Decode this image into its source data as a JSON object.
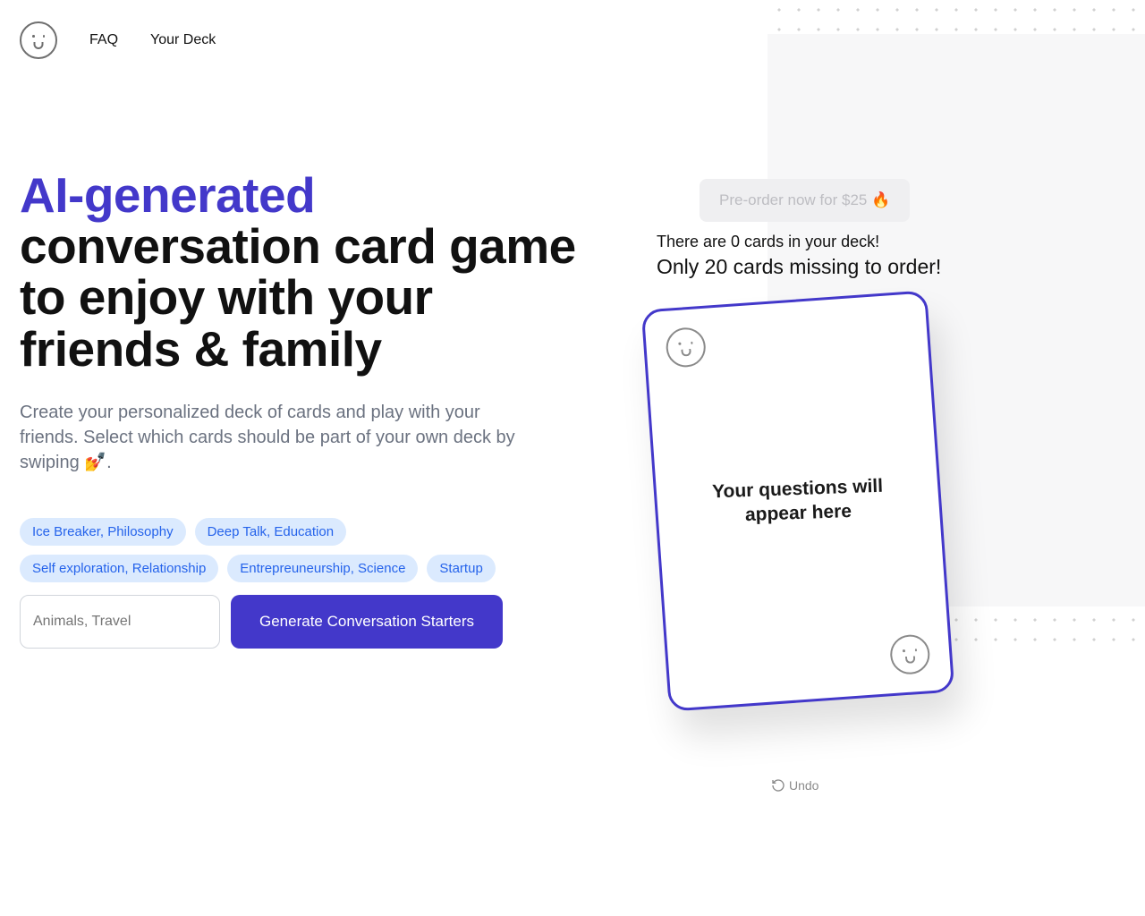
{
  "nav": {
    "faq": "FAQ",
    "your_deck": "Your Deck"
  },
  "hero": {
    "title_accent": "AI-generated",
    "title_rest": "conversation card game to enjoy with your friends & family",
    "subtitle": "Create your personalized deck of cards and play with your friends. Select which cards should be part of your own deck by swiping 💅."
  },
  "chips": [
    "Ice Breaker, Philosophy",
    "Deep Talk, Education",
    "Self exploration, Relationship",
    "Entrepreuneurship, Science",
    "Startup"
  ],
  "input": {
    "placeholder": "Animals, Travel"
  },
  "buttons": {
    "generate": "Generate Conversation Starters",
    "preorder": "Pre-order now for $25 🔥",
    "undo": "Undo"
  },
  "deck": {
    "count_line": "There are 0 cards in your deck!",
    "missing_line": "Only 20 cards missing to order!"
  },
  "card": {
    "placeholder": "Your questions will appear here"
  }
}
